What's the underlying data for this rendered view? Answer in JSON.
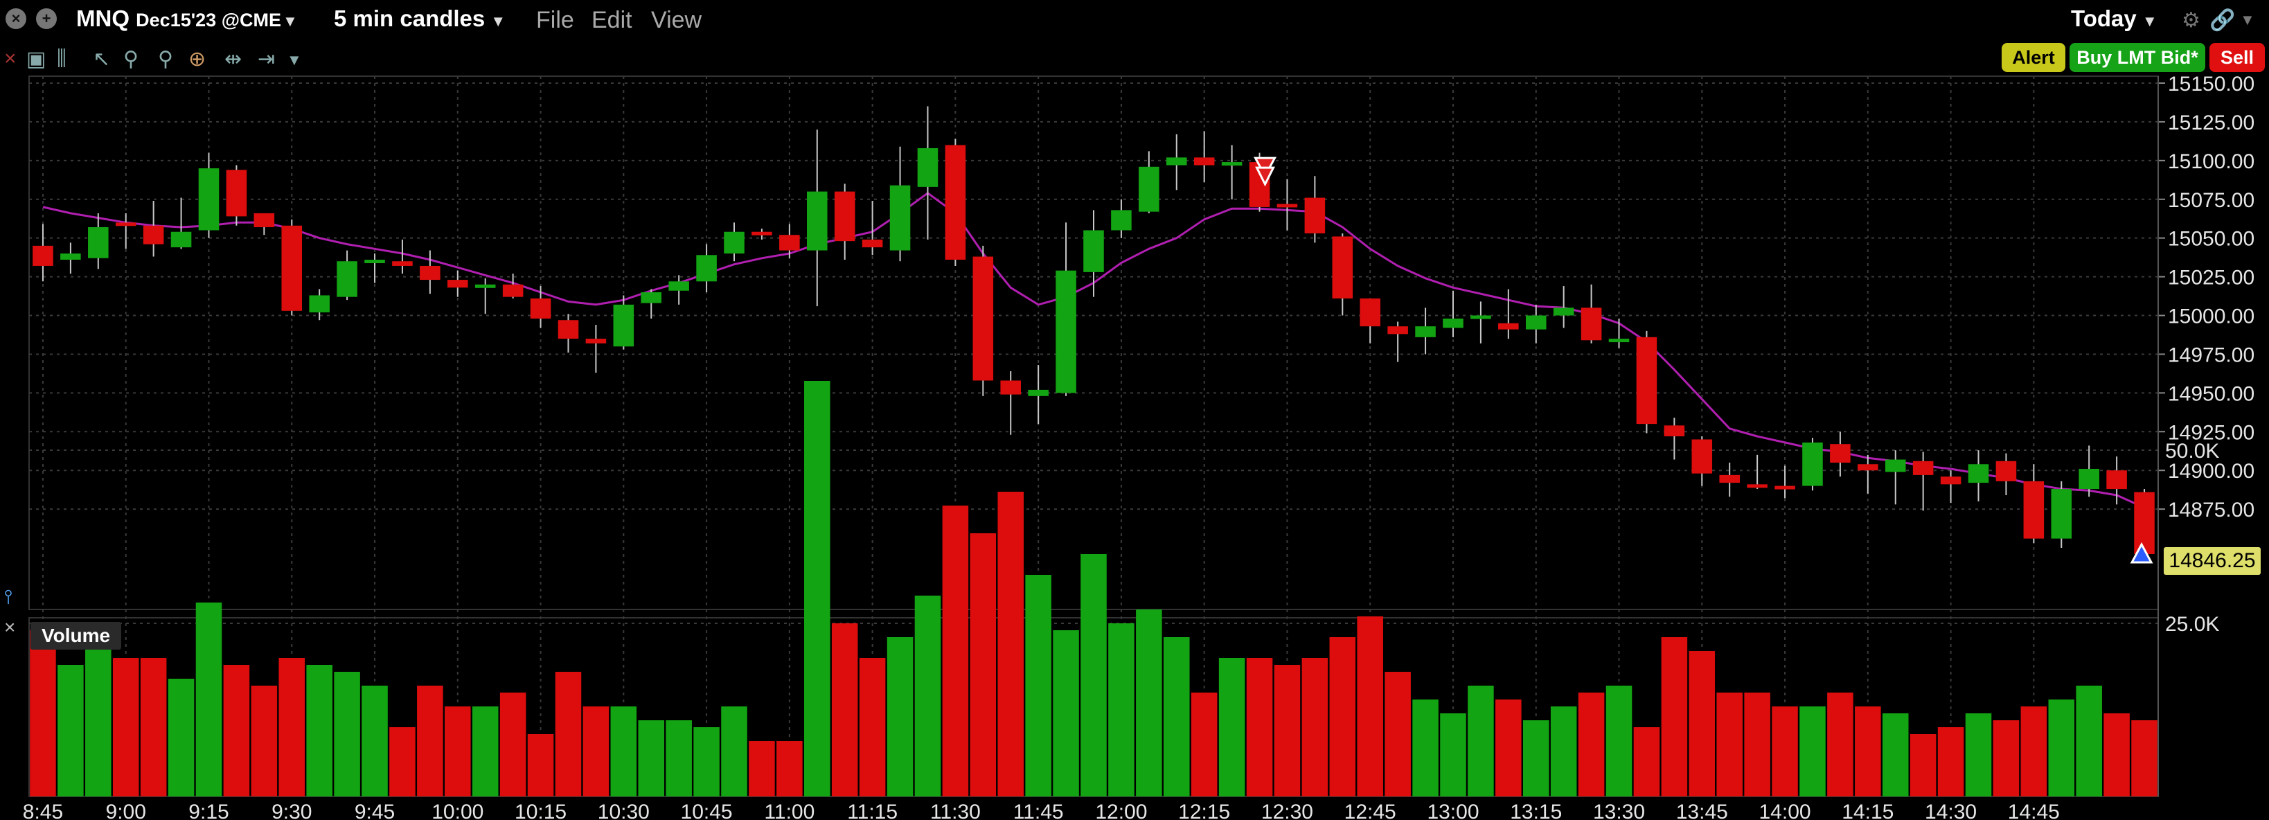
{
  "window": {
    "symbol": "MNQ",
    "contract": "Dec15'23 @CME",
    "interval": "5 min candles",
    "menu": [
      "File",
      "Edit",
      "View"
    ],
    "range": "Today"
  },
  "order_buttons": {
    "alert": "Alert",
    "buy": "Buy LMT Bid*",
    "sell": "Sell"
  },
  "colors": {
    "up": "#13a413",
    "down": "#dd0d0d",
    "ma": "#b01fb0",
    "price_tag": "#dede6a",
    "alert_btn": "#c8c81a",
    "buy_btn": "#17a317",
    "sell_btn": "#e01010"
  },
  "volume_panel": {
    "label": "Volume",
    "ticks": [
      "50.0K",
      "25.0K"
    ]
  },
  "chart_data": {
    "type": "candlestick",
    "price_axis": {
      "ticks": [
        "15150.00",
        "15125.00",
        "15100.00",
        "15075.00",
        "15050.00",
        "15025.00",
        "15000.00",
        "14975.00",
        "14950.00",
        "14925.00",
        "14900.00",
        "14875.00"
      ],
      "last_price": "14846.25"
    },
    "time_labels": [
      "8:45",
      "9:00",
      "9:15",
      "9:30",
      "9:45",
      "10:00",
      "10:15",
      "10:30",
      "10:45",
      "11:00",
      "11:15",
      "11:30",
      "11:45",
      "12:00",
      "12:15",
      "12:30",
      "12:45",
      "13:00",
      "13:15",
      "13:30",
      "13:45",
      "14:00",
      "14:15",
      "14:30",
      "14:45"
    ],
    "candles": [
      [
        15045,
        15032,
        15059,
        15022
      ],
      [
        15036,
        15040,
        15047,
        15027
      ],
      [
        15037,
        15057,
        15066,
        15030
      ],
      [
        15060,
        15058,
        15066,
        15043
      ],
      [
        15058,
        15046,
        15074,
        15038
      ],
      [
        15044,
        15054,
        15076,
        15043
      ],
      [
        15055,
        15095,
        15105,
        15050
      ],
      [
        15094,
        15064,
        15097,
        15058
      ],
      [
        15066,
        15057,
        15064,
        15052
      ],
      [
        15058,
        15003,
        15062,
        15000
      ],
      [
        15002,
        15013,
        15017,
        14997
      ],
      [
        15012,
        15035,
        15042,
        15010
      ],
      [
        15035,
        15036,
        15040,
        15021
      ],
      [
        15035,
        15032,
        15049,
        15027
      ],
      [
        15032,
        15023,
        15042,
        15014
      ],
      [
        15023,
        15018,
        15029,
        15012
      ],
      [
        15018,
        15020,
        15024,
        15001
      ],
      [
        15020,
        15012,
        15027,
        15011
      ],
      [
        15011,
        14998,
        15019,
        14992
      ],
      [
        14997,
        14985,
        15001,
        14976
      ],
      [
        14985,
        14982,
        14994,
        14963
      ],
      [
        14980,
        15007,
        15013,
        14978
      ],
      [
        15008,
        15015,
        15017,
        14998
      ],
      [
        15016,
        15022,
        15026,
        15007
      ],
      [
        15022,
        15039,
        15046,
        15015
      ],
      [
        15040,
        15054,
        15060,
        15035
      ],
      [
        15054,
        15052,
        15056,
        15049
      ],
      [
        15052,
        15042,
        15059,
        15037
      ],
      [
        15042,
        15080,
        15120,
        15006
      ],
      [
        15080,
        15048,
        15085,
        15036
      ],
      [
        15049,
        15044,
        15074,
        15039
      ],
      [
        15042,
        15084,
        15109,
        15035
      ],
      [
        15083,
        15108,
        15135,
        15049
      ],
      [
        15110,
        15036,
        15114,
        15032
      ],
      [
        15038,
        14958,
        15045,
        14948
      ],
      [
        14958,
        14949,
        14964,
        14923
      ],
      [
        14948,
        14952,
        14968,
        14930
      ],
      [
        14950,
        15029,
        15060,
        14948
      ],
      [
        15028,
        15055,
        15068,
        15012
      ],
      [
        15055,
        15068,
        15075,
        15050
      ],
      [
        15067,
        15096,
        15106,
        15066
      ],
      [
        15097,
        15102,
        15117,
        15081
      ],
      [
        15102,
        15097,
        15119,
        15086
      ],
      [
        15099,
        15099,
        15110,
        15075
      ],
      [
        15099,
        15070,
        15105,
        15067
      ],
      [
        15072,
        15071,
        15088,
        15055
      ],
      [
        15076,
        15053,
        15090,
        15047
      ],
      [
        15051,
        15011,
        15053,
        15000
      ],
      [
        15011,
        14993,
        15006,
        14982
      ],
      [
        14993,
        14988,
        14996,
        14970
      ],
      [
        14986,
        14993,
        15005,
        14975
      ],
      [
        14992,
        14998,
        15016,
        14986
      ],
      [
        14998,
        15000,
        15009,
        14982
      ],
      [
        14995,
        14991,
        15017,
        14985
      ],
      [
        14991,
        15000,
        15007,
        14982
      ],
      [
        15000,
        15005,
        15019,
        14992
      ],
      [
        15005,
        14984,
        15020,
        14982
      ],
      [
        14985,
        14985,
        14998,
        14979
      ],
      [
        14986,
        14930,
        14990,
        14924
      ],
      [
        14929,
        14922,
        14934,
        14907
      ],
      [
        14920,
        14898,
        14922,
        14890
      ],
      [
        14897,
        14892,
        14905,
        14883
      ],
      [
        14891,
        14890,
        14910,
        14888
      ],
      [
        14890,
        14889,
        14903,
        14882
      ],
      [
        14890,
        14918,
        14921,
        14887
      ],
      [
        14917,
        14905,
        14925,
        14896
      ],
      [
        14904,
        14900,
        14910,
        14885
      ],
      [
        14899,
        14907,
        14913,
        14878
      ],
      [
        14906,
        14897,
        14912,
        14874
      ],
      [
        14896,
        14891,
        14900,
        14879
      ],
      [
        14892,
        14904,
        14913,
        14880
      ],
      [
        14906,
        14893,
        14911,
        14884
      ],
      [
        14893,
        14856,
        14904,
        14853
      ],
      [
        14856,
        14888,
        14893,
        14850
      ],
      [
        14888,
        14901,
        14916,
        14883
      ],
      [
        14900,
        14888,
        14909,
        14878
      ],
      [
        14886,
        14846,
        14888,
        14840
      ]
    ],
    "ma": [
      15070,
      15066,
      15063,
      15060,
      15058,
      15057,
      15058,
      15060,
      15060,
      15056,
      15050,
      15046,
      15043,
      15040,
      15036,
      15031,
      15026,
      15021,
      15015,
      15009,
      15007,
      15010,
      15016,
      15021,
      15027,
      15033,
      15037,
      15040,
      15046,
      15050,
      15054,
      15066,
      15079,
      15066,
      15040,
      15018,
      15007,
      15012,
      15021,
      15034,
      15043,
      15050,
      15062,
      15069,
      15069,
      15068,
      15067,
      15057,
      15043,
      15032,
      15024,
      15018,
      15014,
      15010,
      15006,
      15005,
      15001,
      14995,
      14983,
      14965,
      14946,
      14927,
      14922,
      14918,
      14914,
      14912,
      14908,
      14906,
      14903,
      14901,
      14898,
      14895,
      14891,
      14888,
      14887,
      14884,
      14876
    ],
    "volume": [
      24,
      19,
      22,
      20,
      20,
      17,
      28,
      19,
      16,
      20,
      19,
      18,
      16,
      10,
      16,
      13,
      13,
      15,
      9,
      18,
      13,
      13,
      11,
      11,
      10,
      13,
      8,
      8,
      60,
      25,
      20,
      23,
      29,
      42,
      38,
      44,
      32,
      24,
      35,
      25,
      27,
      23,
      15,
      20,
      20,
      19,
      20,
      23,
      26,
      18,
      14,
      12,
      16,
      14,
      11,
      13,
      15,
      16,
      10,
      23,
      21,
      15,
      15,
      13,
      13,
      15,
      13,
      12,
      9,
      10,
      12,
      11,
      13,
      14,
      16,
      12,
      11
    ],
    "alert_marker": "12:20",
    "execution_marker": "14:55"
  }
}
